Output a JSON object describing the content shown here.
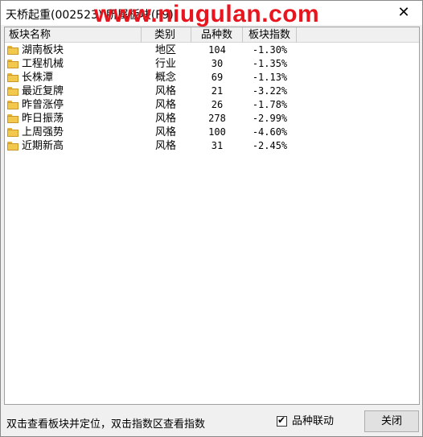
{
  "window": {
    "title": "天桥起重(002523) 所属板块(F9)",
    "watermark": "www.niugulan.com",
    "close_glyph": "✕"
  },
  "table": {
    "columns": [
      "板块名称",
      "类别",
      "品种数",
      "板块指数"
    ],
    "rows": [
      {
        "name": "湖南板块",
        "type": "地区",
        "count": "104",
        "index": "-1.30%"
      },
      {
        "name": "工程机械",
        "type": "行业",
        "count": "30",
        "index": "-1.35%"
      },
      {
        "name": "长株潭",
        "type": "概念",
        "count": "69",
        "index": "-1.13%"
      },
      {
        "name": "最近复牌",
        "type": "风格",
        "count": "21",
        "index": "-3.22%"
      },
      {
        "name": "昨曾涨停",
        "type": "风格",
        "count": "26",
        "index": "-1.78%"
      },
      {
        "name": "昨日振荡",
        "type": "风格",
        "count": "278",
        "index": "-2.99%"
      },
      {
        "name": "上周强势",
        "type": "风格",
        "count": "100",
        "index": "-4.60%"
      },
      {
        "name": "近期新高",
        "type": "风格",
        "count": "31",
        "index": "-2.45%"
      }
    ]
  },
  "footer": {
    "hint": "双击查看板块并定位，双击指数区查看指数",
    "checkbox_label": "品种联动",
    "checkbox_checked": true,
    "close_button": "关闭"
  },
  "colors": {
    "watermark": "#e8141e",
    "folder": "#f2c94c"
  }
}
